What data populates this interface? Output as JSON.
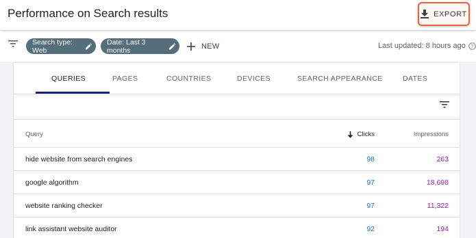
{
  "header": {
    "title": "Performance on Search results",
    "export_label": "EXPORT"
  },
  "filters": {
    "chips": [
      "Search type: Web",
      "Date: Last 3 months"
    ],
    "new_label": "NEW",
    "last_updated": "Last updated: 8 hours ago"
  },
  "tabs": [
    {
      "label": "QUERIES",
      "active": true
    },
    {
      "label": "PAGES",
      "active": false
    },
    {
      "label": "COUNTRIES",
      "active": false
    },
    {
      "label": "DEVICES",
      "active": false
    },
    {
      "label": "SEARCH APPEARANCE",
      "active": false
    },
    {
      "label": "DATES",
      "active": false
    }
  ],
  "table": {
    "columns": {
      "query": "Query",
      "clicks": "Clicks",
      "impressions": "Impressions"
    },
    "sort": "clicks-descending",
    "rows": [
      {
        "query": "hide website from search engines",
        "clicks": "98",
        "impressions": "263"
      },
      {
        "query": "google algorithm",
        "clicks": "97",
        "impressions": "18,698"
      },
      {
        "query": "website ranking checker",
        "clicks": "97",
        "impressions": "11,322"
      },
      {
        "query": "link assistant website auditor",
        "clicks": "92",
        "impressions": "194"
      }
    ]
  },
  "icons": {
    "export": "download-icon",
    "filter": "filter-icon",
    "chip_edit": "pencil-icon",
    "new": "plus-icon",
    "help": "help-icon",
    "sort": "arrow-down-icon"
  },
  "colors": {
    "chip": "#546e7a",
    "clicks": "#1a73e8",
    "impressions": "#8e24aa",
    "export_highlight": "#e8643a",
    "active_tab": "#1a237e"
  }
}
